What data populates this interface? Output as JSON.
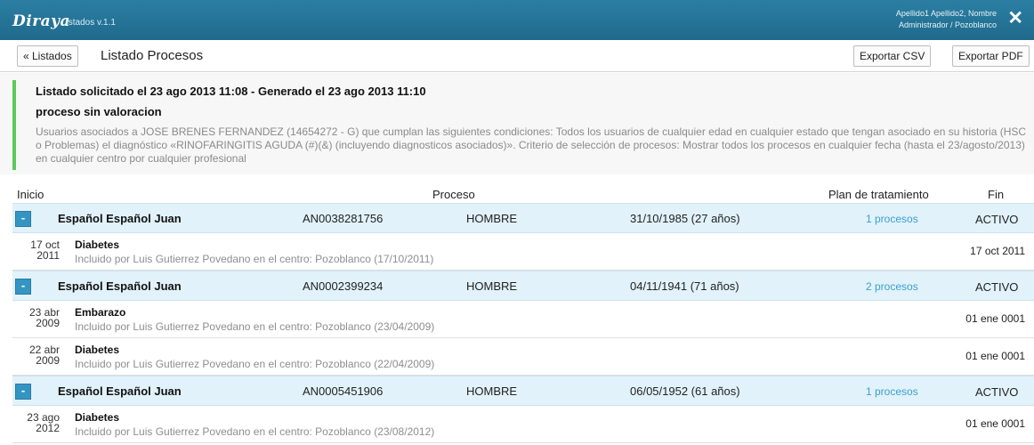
{
  "app": {
    "logo": "Diraya",
    "subtitle": "Listados v.1.1",
    "user_line1": "Apellido1 Apellido2, Nombre",
    "user_line2": "Administrador / Pozoblanco",
    "close_icon": "close-icon"
  },
  "toolbar": {
    "back_label": "« Listados",
    "title": "Listado Procesos",
    "csv_label": "Exportar CSV",
    "pdf_label": "Exportar PDF"
  },
  "summary": {
    "title": "Listado solicitado el 23 ago 2013 11:08 - Generado el 23 ago 2013 11:10",
    "subtitle": "proceso sin valoracion",
    "description": "Usuarios asociados a JOSE BRENES FERNANDEZ (14654272 - G) que cumplan las siguientes condiciones: Todos los usuarios de cualquier edad en cualquier estado que tengan asociado en su historia (HSC o Problemas) el diagnóstico «RINOFARINGITIS AGUDA (#)(&) (incluyendo diagnosticos asociados)». Criterio de selección de procesos: Mostrar todos los procesos en cualquier fecha (hasta el 23/agosto/2013) en cualquier centro por cualquier profesional"
  },
  "columns": {
    "inicio": "Inicio",
    "proceso": "Proceso",
    "plan": "Plan de tratamiento",
    "fin": "Fin"
  },
  "patients": [
    {
      "toggle": "-",
      "name": "Español Español Juan",
      "id": "AN0038281756",
      "sex": "HOMBRE",
      "birth": "31/10/1985 (27 años)",
      "plan": "1 procesos",
      "fin": "ACTIVO",
      "processes": [
        {
          "date_top": "17 oct",
          "date_year": "2011",
          "name": "Diabetes",
          "detail": "Incluido por Luis Gutierrez Povedano en el centro: Pozoblanco (17/10/2011)",
          "fin": "17 oct 2011"
        }
      ]
    },
    {
      "toggle": "-",
      "name": "Español Español Juan",
      "id": "AN0002399234",
      "sex": "HOMBRE",
      "birth": "04/11/1941 (71 años)",
      "plan": "2 procesos",
      "fin": "ACTIVO",
      "processes": [
        {
          "date_top": "23 abr",
          "date_year": "2009",
          "name": "Embarazo",
          "detail": "Incluido por Luis Gutierrez Povedano en el centro: Pozoblanco (23/04/2009)",
          "fin": "01 ene 0001"
        },
        {
          "date_top": "22 abr",
          "date_year": "2009",
          "name": "Diabetes",
          "detail": "Incluido por Luis Gutierrez Povedano en el centro: Pozoblanco (22/04/2009)",
          "fin": "01 ene 0001"
        }
      ]
    },
    {
      "toggle": "-",
      "name": "Español Español Juan",
      "id": "AN0005451906",
      "sex": "HOMBRE",
      "birth": "06/05/1952 (61 años)",
      "plan": "1 procesos",
      "fin": "ACTIVO",
      "processes": [
        {
          "date_top": "23 ago",
          "date_year": "2012",
          "name": "Diabetes",
          "detail": "Incluido por Luis Gutierrez Povedano en el centro: Pozoblanco (23/08/2012)",
          "fin": "01 ene 0001"
        }
      ]
    }
  ]
}
